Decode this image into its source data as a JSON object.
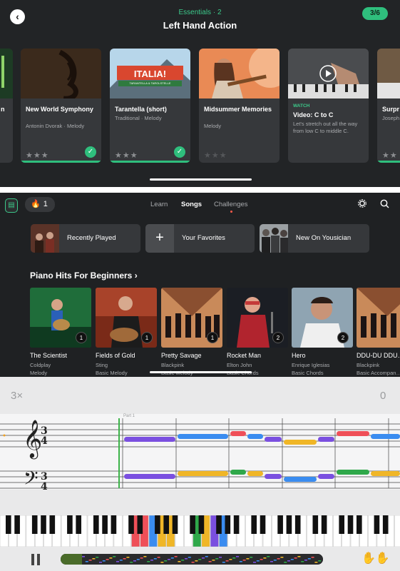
{
  "lesson": {
    "subtitle": "Essentials · 2",
    "title": "Left Hand Action",
    "progress": "3/6",
    "cards": [
      {
        "title": "…n",
        "subtitle": ""
      },
      {
        "title": "New World Symphony",
        "subtitle": "Antonin Dvorak · Melody",
        "stars": 3,
        "completed": true
      },
      {
        "title": "Tarantella (short)",
        "subtitle": "Traditional · Melody",
        "stars": 3,
        "completed": true,
        "thumb_text": "ITALIA!",
        "thumb_sub": "TARANTELLA & TAROLSTELLE"
      },
      {
        "title": "Midsummer Memories",
        "subtitle": "Melody",
        "stars": 0,
        "completed": false
      },
      {
        "tag": "WATCH",
        "title": "Video: C to C",
        "subtitle": "Let's stretch out all the way from low C to middle C."
      },
      {
        "title": "Surpr…",
        "subtitle": "Joseph…"
      }
    ]
  },
  "songs_screen": {
    "streak_count": "1",
    "tabs": [
      "Learn",
      "Songs",
      "Challenges"
    ],
    "active_tab": "Songs",
    "quick_links": [
      "Recently Played",
      "Your Favorites",
      "New On Yousician"
    ],
    "plus_glyph": "+",
    "section_title": "Piano Hits For Beginners",
    "section_chevron": "›",
    "songs": [
      {
        "name": "The Scientist",
        "artist": "Coldplay",
        "level": "Melody",
        "badge": "1"
      },
      {
        "name": "Fields of Gold",
        "artist": "Sting",
        "level": "Basic Melody",
        "badge": "1"
      },
      {
        "name": "Pretty Savage",
        "artist": "Blackpink",
        "level": "Basic Melody",
        "badge": "1"
      },
      {
        "name": "Rocket Man",
        "artist": "Elton John",
        "level": "Basic Chords",
        "badge": "2"
      },
      {
        "name": "Hero",
        "artist": "Enrique Iglesias",
        "level": "Basic Chords",
        "badge": "2"
      },
      {
        "name": "DDU-DU DDU…",
        "artist": "Blackpink",
        "level": "Basic Accompan…",
        "badge": ""
      }
    ]
  },
  "player": {
    "speed": "3×",
    "score": "0",
    "part_label": "Part 1",
    "time_signature": [
      "3",
      "4"
    ]
  },
  "colors": {
    "accent_green": "#2fbf7d",
    "note_purple": "#7a4fe0",
    "note_blue": "#3a8cf0",
    "note_red": "#ef4f58",
    "note_green": "#2fa84a",
    "note_yellow": "#f0b627"
  }
}
